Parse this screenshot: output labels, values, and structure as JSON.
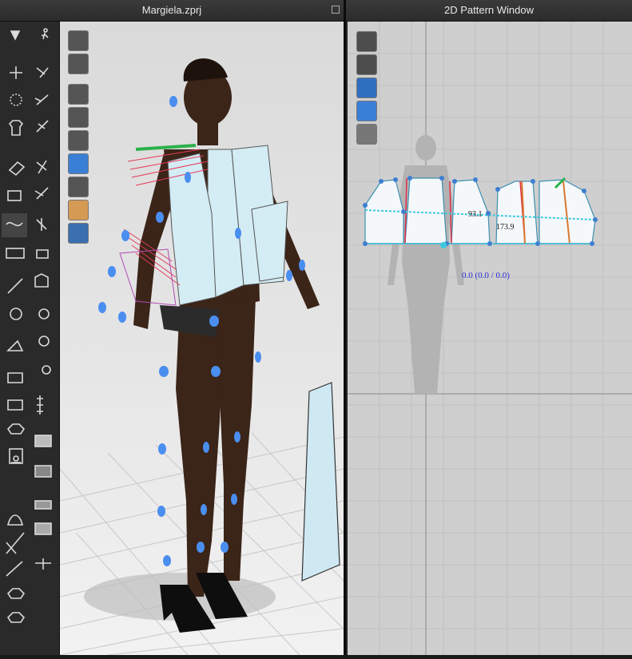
{
  "window_3d": {
    "title": "Margiela.zprj"
  },
  "window_2d": {
    "title": "2D Pattern Window",
    "coordinate_readout": "0.0 (0.0 / 0.0)",
    "measurement_a": "93.1",
    "measurement_b": "173.9"
  },
  "toolbar_3d": [
    "simulate-icon",
    "walk-icon",
    "move-icon",
    "select-mesh-icon",
    "transform-icon",
    "pen-icon",
    "garment-icon",
    "brush-icon",
    "fold-icon",
    "pin-icon",
    "arrange-icon",
    "stitch-icon",
    "sewing-icon",
    "pucker-icon",
    "tape-icon",
    "zipper-icon",
    "needle-icon",
    "elastic-icon",
    "button-icon",
    "topstitch-icon",
    "steam-icon",
    "lock-icon",
    "fold-arrange-icon",
    "zip-icon",
    "avatar-measure-icon",
    "fabric-icon",
    "figure-icon",
    "solid-icon",
    "measure-icon",
    "rule-icon",
    "ruler-icon",
    "spread-icon",
    "hide-icon",
    "show-icon"
  ],
  "viewport_3d_tools": [
    "show-avatar-icon",
    "show-garment-icon",
    "eye-garment-icon",
    "eye-pattern-icon",
    "eye-avatar-icon",
    "texture-icon",
    "shadow-icon",
    "skin-icon",
    "globe-icon"
  ],
  "viewport_2d_tools": [
    "visibility-icon",
    "garment-view-icon",
    "info-icon",
    "texture-view-icon",
    "lock-view-icon"
  ],
  "colors": {
    "accent_blue": "#3b82f6",
    "pin_blue": "#4a8ef0",
    "pattern_fill": "#d8eef5"
  }
}
